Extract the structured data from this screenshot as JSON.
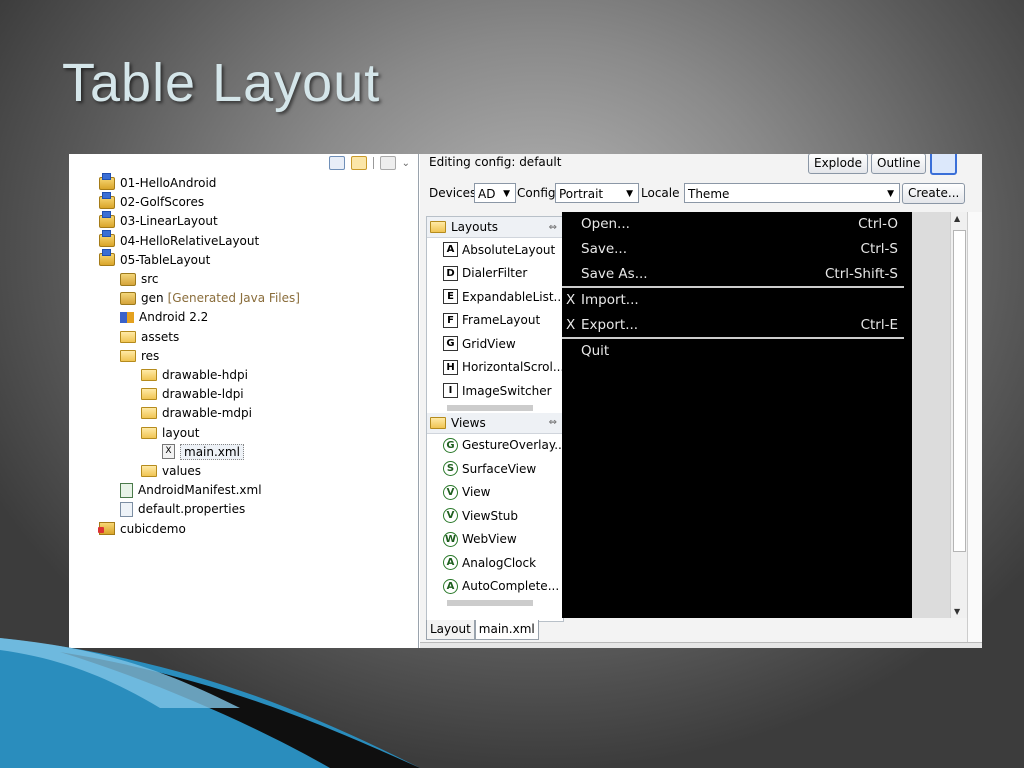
{
  "slide": {
    "title": "Table Layout"
  },
  "explorer": {
    "items": [
      {
        "label": "01-HelloAndroid",
        "icon": "project-folder-icon",
        "depth": 0
      },
      {
        "label": "02-GolfScores",
        "icon": "project-folder-icon",
        "depth": 0
      },
      {
        "label": "03-LinearLayout",
        "icon": "project-folder-icon",
        "depth": 0
      },
      {
        "label": "04-HelloRelativeLayout",
        "icon": "project-folder-icon",
        "depth": 0
      },
      {
        "label": "05-TableLayout",
        "icon": "project-folder-icon",
        "depth": 0
      },
      {
        "label": "src",
        "icon": "source-folder-icon",
        "depth": 1
      },
      {
        "label": "gen",
        "note": "[Generated Java Files]",
        "icon": "source-folder-icon",
        "depth": 1
      },
      {
        "label": "Android 2.2",
        "icon": "library-icon",
        "depth": 1
      },
      {
        "label": "assets",
        "icon": "folder-icon",
        "depth": 1
      },
      {
        "label": "res",
        "icon": "folder-icon",
        "depth": 1
      },
      {
        "label": "drawable-hdpi",
        "icon": "folder-icon",
        "depth": 2
      },
      {
        "label": "drawable-ldpi",
        "icon": "folder-icon",
        "depth": 2
      },
      {
        "label": "drawable-mdpi",
        "icon": "folder-icon",
        "depth": 2
      },
      {
        "label": "layout",
        "icon": "folder-icon",
        "depth": 2
      },
      {
        "label": "main.xml",
        "icon": "xml-file-icon",
        "depth": 3,
        "selected": true
      },
      {
        "label": "values",
        "icon": "folder-icon",
        "depth": 2
      },
      {
        "label": "AndroidManifest.xml",
        "icon": "manifest-file-icon",
        "depth": 1
      },
      {
        "label": "default.properties",
        "icon": "properties-file-icon",
        "depth": 1
      },
      {
        "label": "cubicdemo",
        "icon": "project-error-icon",
        "depth": 0
      }
    ]
  },
  "editor": {
    "config_label": "Editing config:  default",
    "explode_label": "Explode",
    "outline_label": "Outline",
    "devices_label": "Devices",
    "devices_value": "AD",
    "config_short_label": "Config",
    "config_value": "Portrait",
    "locale_label": "Locale",
    "theme_value": "Theme",
    "create_label": "Create...",
    "palette": {
      "layouts_header": "Layouts",
      "layouts": [
        {
          "badge": "A",
          "label": "AbsoluteLayout"
        },
        {
          "badge": "D",
          "label": "DialerFilter"
        },
        {
          "badge": "E",
          "label": "ExpandableList..."
        },
        {
          "badge": "F",
          "label": "FrameLayout"
        },
        {
          "badge": "G",
          "label": "GridView"
        },
        {
          "badge": "H",
          "label": "HorizontalScrol..."
        },
        {
          "badge": "I",
          "label": "ImageSwitcher"
        }
      ],
      "views_header": "Views",
      "views": [
        {
          "badge": "G",
          "label": "GestureOverlay..."
        },
        {
          "badge": "S",
          "label": "SurfaceView"
        },
        {
          "badge": "V",
          "label": "View"
        },
        {
          "badge": "V",
          "label": "ViewStub"
        },
        {
          "badge": "W",
          "label": "WebView"
        },
        {
          "badge": "A",
          "label": "AnalogClock"
        },
        {
          "badge": "A",
          "label": "AutoComplete..."
        }
      ]
    },
    "menu": [
      {
        "mark": "",
        "label": "Open...",
        "shortcut": "Ctrl-O"
      },
      {
        "mark": "",
        "label": "Save...",
        "shortcut": "Ctrl-S"
      },
      {
        "mark": "",
        "label": "Save As...",
        "shortcut": "Ctrl-Shift-S"
      },
      {
        "mark": "X",
        "label": "Import...",
        "shortcut": ""
      },
      {
        "mark": "X",
        "label": "Export...",
        "shortcut": "Ctrl-E"
      },
      {
        "mark": "",
        "label": "Quit",
        "shortcut": ""
      }
    ],
    "tabs": [
      "Layout",
      "main.xml"
    ]
  }
}
